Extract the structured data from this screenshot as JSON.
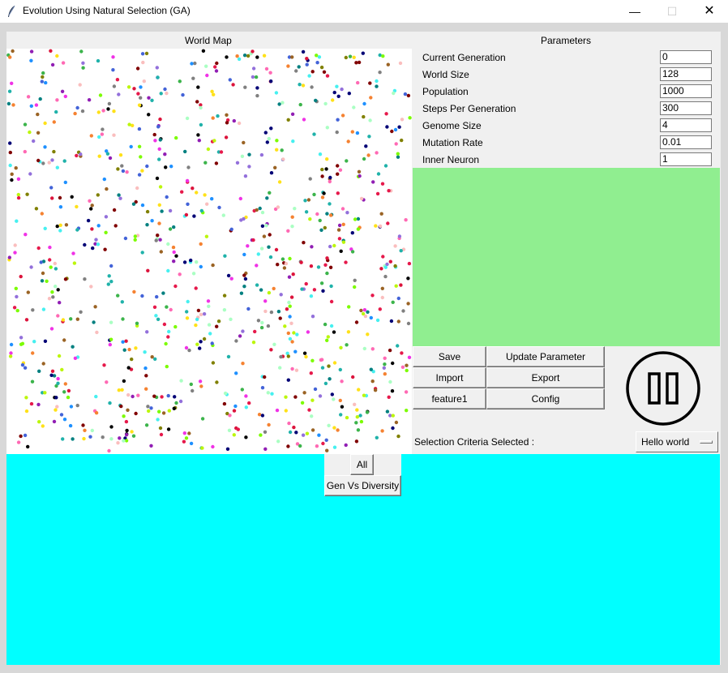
{
  "window": {
    "title": "Evolution Using Natural Selection (GA)",
    "controls": {
      "minimize": "—",
      "maximize": "☐",
      "close": "✕"
    }
  },
  "world_map": {
    "title": "World Map",
    "dot_colors": [
      "#e6194b",
      "#3cb44b",
      "#ffe119",
      "#4363d8",
      "#f58231",
      "#911eb4",
      "#46f0f0",
      "#f032e6",
      "#bcf60c",
      "#fabebe",
      "#008080",
      "#9a6324",
      "#800000",
      "#aaffc3",
      "#808000",
      "#000075",
      "#808080",
      "#000000",
      "#ff69b4",
      "#7cfc00",
      "#1e90ff",
      "#dc143c",
      "#9370db",
      "#20b2aa"
    ]
  },
  "parameters": {
    "title": "Parameters",
    "fields": [
      {
        "label": "Current Generation",
        "value": "0"
      },
      {
        "label": "World Size",
        "value": "128"
      },
      {
        "label": "Population",
        "value": "1000"
      },
      {
        "label": "Steps Per Generation",
        "value": "300"
      },
      {
        "label": "Genome Size",
        "value": "4"
      },
      {
        "label": "Mutation Rate",
        "value": "0.01"
      },
      {
        "label": "Inner Neuron",
        "value": "1"
      }
    ]
  },
  "buttons": {
    "save": "Save",
    "update_parameter": "Update Parameter",
    "import": "Import",
    "export": "Export",
    "feature1": "feature1",
    "config": "Config",
    "all": "All",
    "gen_vs_diversity": "Gen Vs Diversity",
    "pause_icon": "pause-icon"
  },
  "selection": {
    "label": "Selection Criteria Selected :",
    "value": "Hello world"
  },
  "colors": {
    "green_panel": "#90ee90",
    "cyan_panel": "#00ffff",
    "background": "#f0f0f0"
  }
}
